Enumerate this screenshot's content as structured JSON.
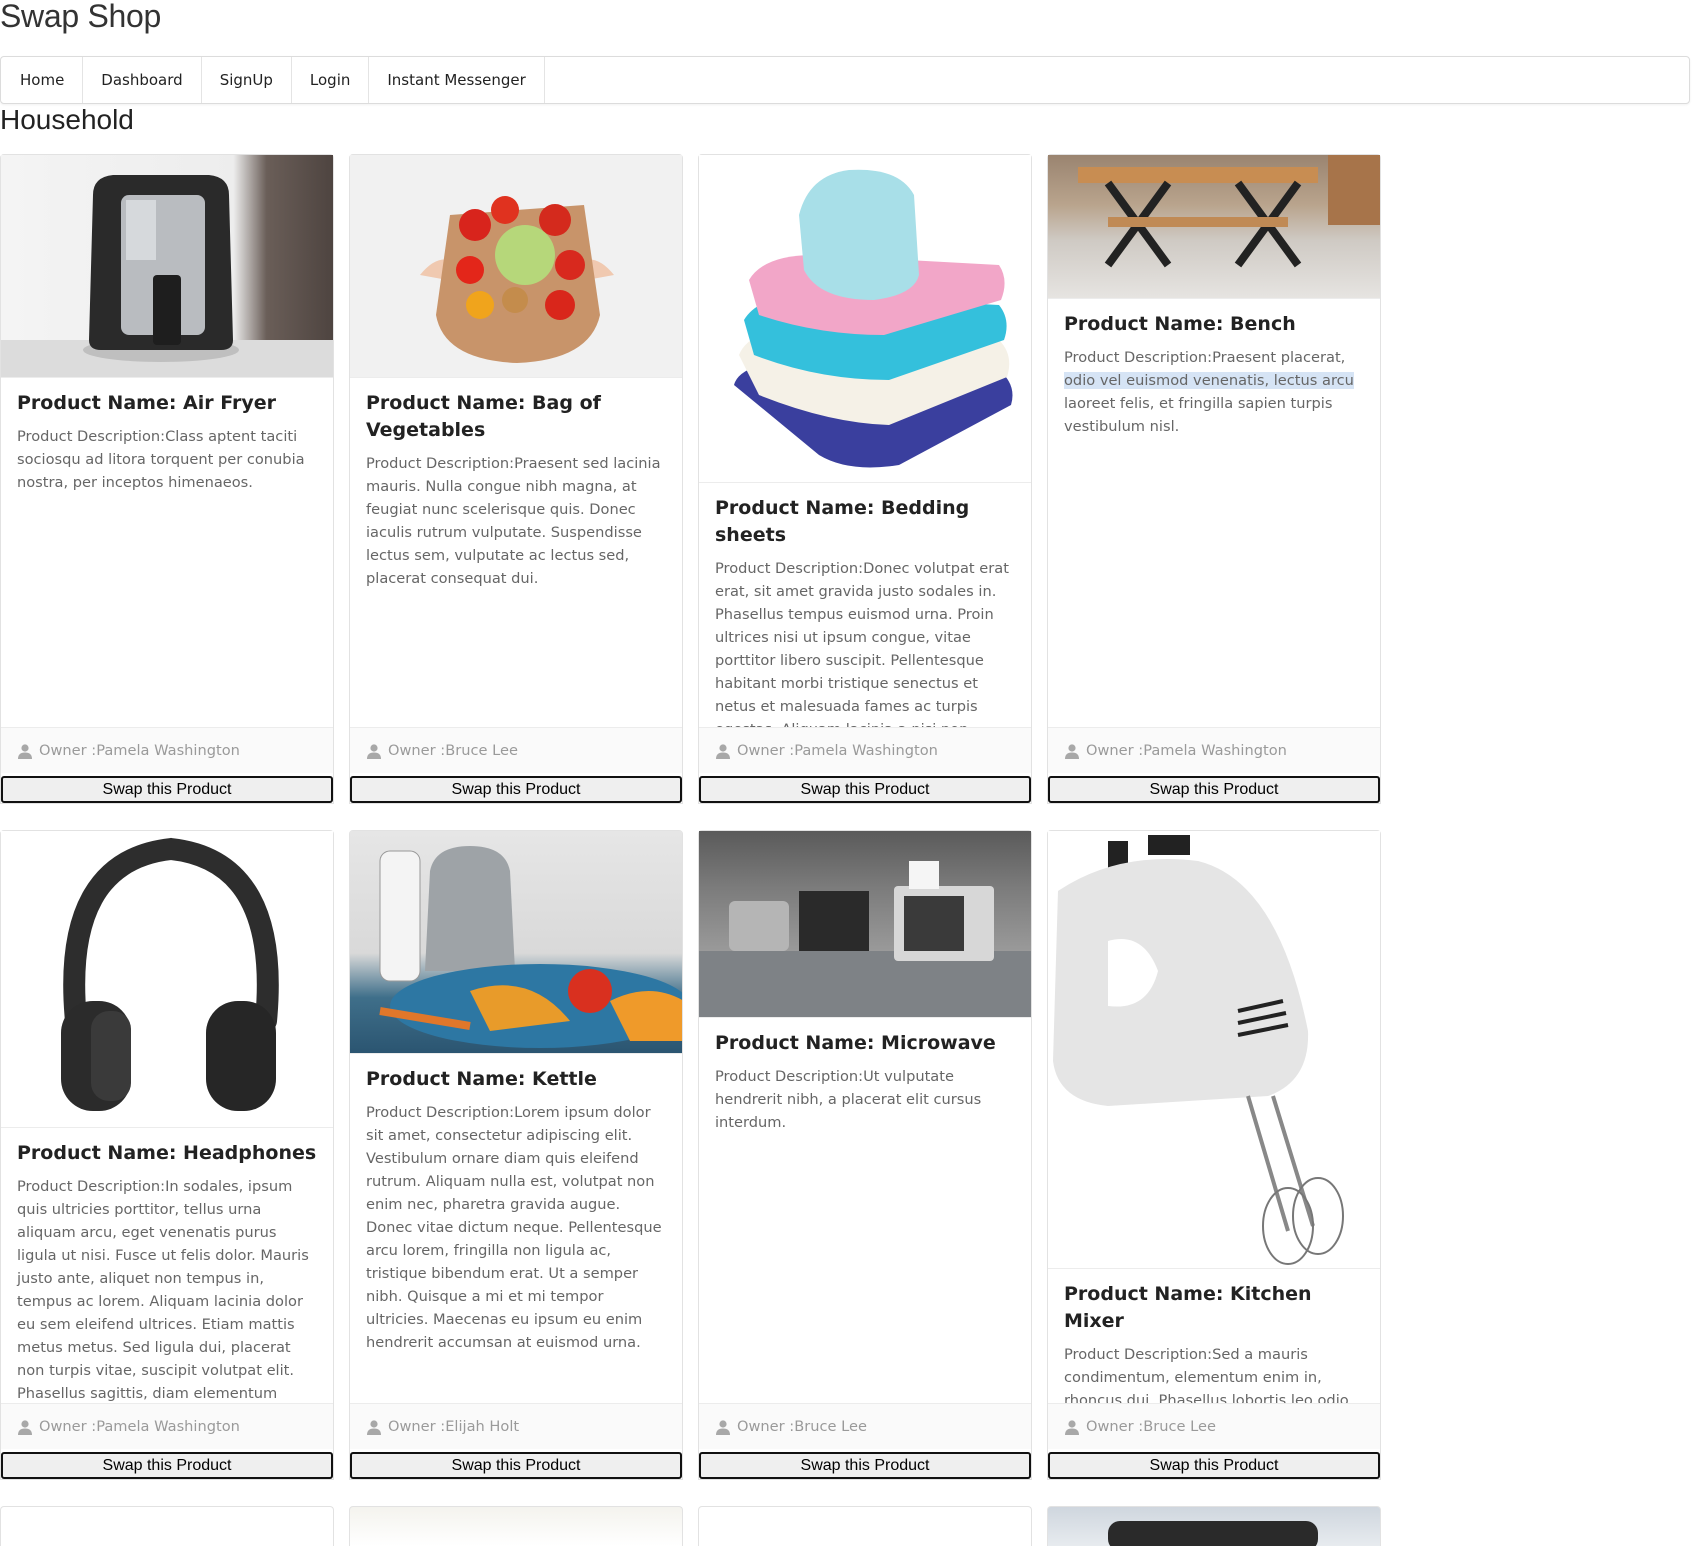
{
  "site": {
    "title": "Swap Shop"
  },
  "nav": {
    "items": [
      {
        "label": "Home"
      },
      {
        "label": "Dashboard"
      },
      {
        "label": "SignUp"
      },
      {
        "label": "Login"
      },
      {
        "label": "Instant Messenger"
      }
    ]
  },
  "category": {
    "title": "Household"
  },
  "swap_label": "Swap this Product",
  "owner_icon": "person-icon",
  "products": [
    {
      "name": "Product Name: Air Fryer",
      "description": "Product Description:Class aptent taciti sociosqu ad litora torquent per conubia nostra, per inceptos himenaeos.",
      "owner": "Owner :Pamela Washington"
    },
    {
      "name": "Product Name: Bag of Vegetables",
      "description": "Product Description:Praesent sed lacinia mauris. Nulla congue nibh magna, at feugiat nunc scelerisque quis. Donec iaculis rutrum vulputate. Suspendisse lectus sem, vulputate ac lectus sed, placerat consequat dui.",
      "owner": "Owner :Bruce Lee"
    },
    {
      "name": "Product Name: Bedding sheets",
      "description": "Product Description:Donec volutpat erat erat, sit amet gravida justo sodales in. Phasellus tempus euismod urna. Proin ultrices nisi ut ipsum congue, vitae porttitor libero suscipit. Pellentesque habitant morbi tristique senectus et netus et malesuada fames ac turpis egestas. Aliquam lacinia a nisi non congue.",
      "owner": "Owner :Pamela Washington"
    },
    {
      "name": "Product Name: Bench",
      "description_before": "Product Description:Praesent placerat,",
      "description_highlight": "odio vel euismod venenatis, lectus arcu",
      "description_after": "laoreet felis, et fringilla sapien turpis vestibulum nisl.",
      "owner": "Owner :Pamela Washington"
    },
    {
      "name": "Product Name: Headphones",
      "description": "Product Description:In sodales, ipsum quis ultricies porttitor, tellus urna aliquam arcu, eget venenatis purus ligula ut nisi. Fusce ut felis dolor. Mauris justo ante, aliquet non tempus in, tempus ac lorem. Aliquam lacinia dolor eu sem eleifend ultrices. Etiam mattis metus metus. Sed ligula dui, placerat non turpis vitae, suscipit volutpat elit. Phasellus sagittis, diam elementum suscipit fringilla, libero mauris scelerisque ex, ac interdum diam erat non sapien.",
      "owner": "Owner :Pamela Washington"
    },
    {
      "name": "Product Name: Kettle",
      "description": "Product Description:Lorem ipsum dolor sit amet, consectetur adipiscing elit. Vestibulum ornare diam quis eleifend rutrum. Aliquam nulla est, volutpat non enim nec, pharetra gravida augue. Donec vitae dictum neque. Pellentesque arcu lorem, fringilla non ligula ac, tristique bibendum erat. Ut a semper nibh. Quisque a mi et mi tempor ultricies. Maecenas eu ipsum eu enim hendrerit accumsan at euismod urna.",
      "owner": "Owner :Elijah Holt"
    },
    {
      "name": "Product Name: Microwave",
      "description": "Product Description:Ut vulputate hendrerit nibh, a placerat elit cursus interdum.",
      "owner": "Owner :Bruce Lee"
    },
    {
      "name": "Product Name: Kitchen Mixer",
      "description": "Product Description:Sed a mauris condimentum, elementum enim in, rhoncus dui. Phasellus lobortis leo odio, sit amet pharetra turpis porta quis.",
      "owner": "Owner :Bruce Lee"
    }
  ]
}
